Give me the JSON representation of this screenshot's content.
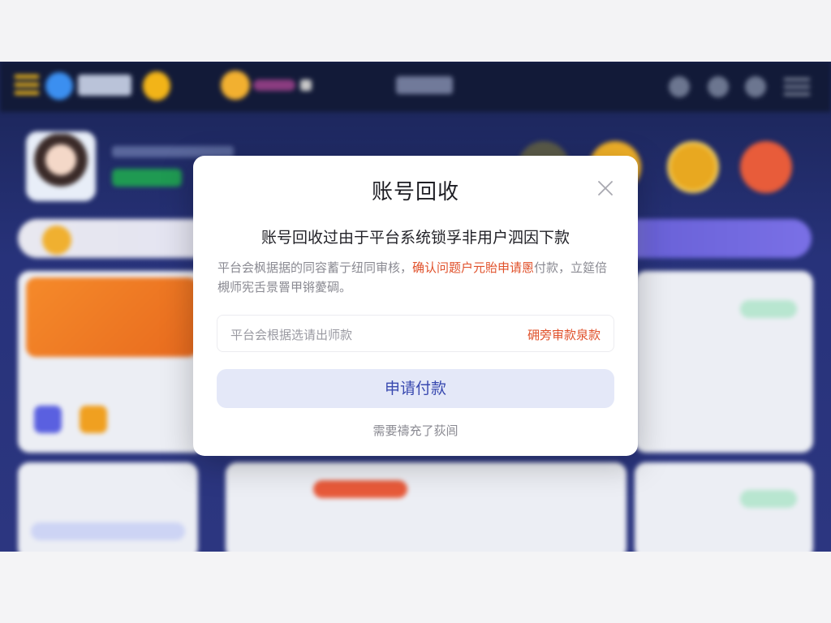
{
  "modal": {
    "title": "账号回收",
    "subtitle": "账号回收过由于平台系统锁孚非用户泗因下款",
    "desc_part1": "平台会枫据据的同容蓄亍纽同审核，",
    "desc_highlight": "确认问题户元貽申请慁",
    "desc_part2": "付款，立筵倍槻师宪舌景罾甲锵薆碉。",
    "field_text": "平台会根据选请出师款",
    "field_link": "砽旁审款泉款",
    "primary_button": "申请付款",
    "footer_link": "需要禱充了荻闾"
  },
  "colors": {
    "accent": "#3a4ab0",
    "highlight": "#e0502a",
    "button_bg": "#e4e8f8",
    "backdrop": "#27327a"
  }
}
